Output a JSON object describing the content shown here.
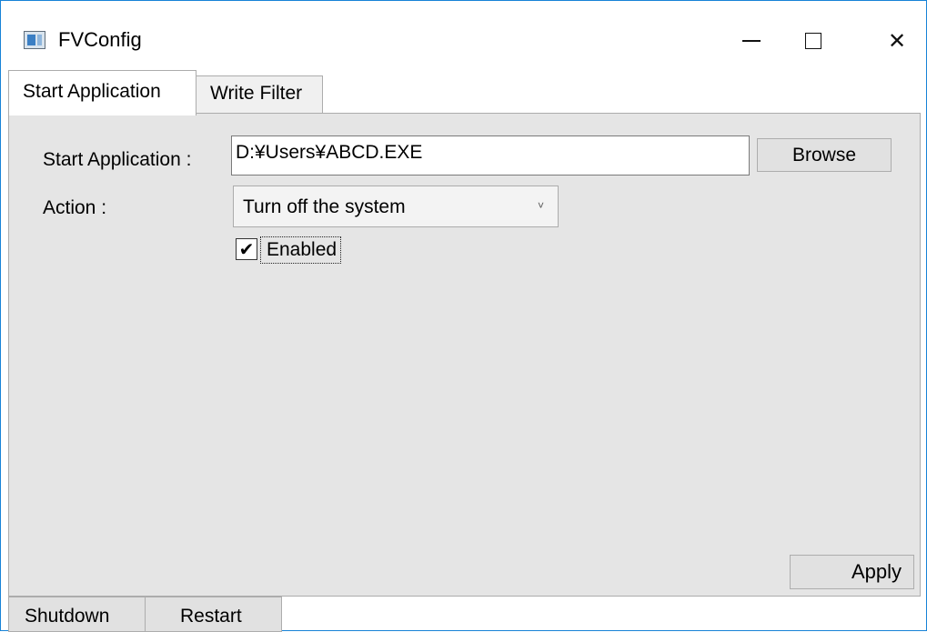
{
  "window": {
    "title": "FVConfig",
    "accent_color": "#1883d7",
    "controls": {
      "minimize": "—",
      "close": "✕"
    }
  },
  "tabs": [
    {
      "label": "Start Application",
      "active": true
    },
    {
      "label": "Write Filter",
      "active": false
    }
  ],
  "start_app": {
    "label": "Start Application :",
    "path_value": "D:¥Users¥ABCD.EXE",
    "browse_label": "Browse"
  },
  "action": {
    "label": "Action :",
    "selected": "Turn off the system",
    "arrow": "˅"
  },
  "enabled": {
    "label": "Enabled",
    "checked": true,
    "checkmark": "✔"
  },
  "apply_label": "Apply",
  "bottom": {
    "shutdown_label": "Shutdown",
    "restart_label": "Restart"
  },
  "icons": {
    "app": "window-app-icon",
    "minimize": "minimize-icon",
    "maximize": "maximize-icon",
    "close": "close-icon",
    "dropdown": "chevron-down-icon",
    "check": "checkmark-icon"
  }
}
